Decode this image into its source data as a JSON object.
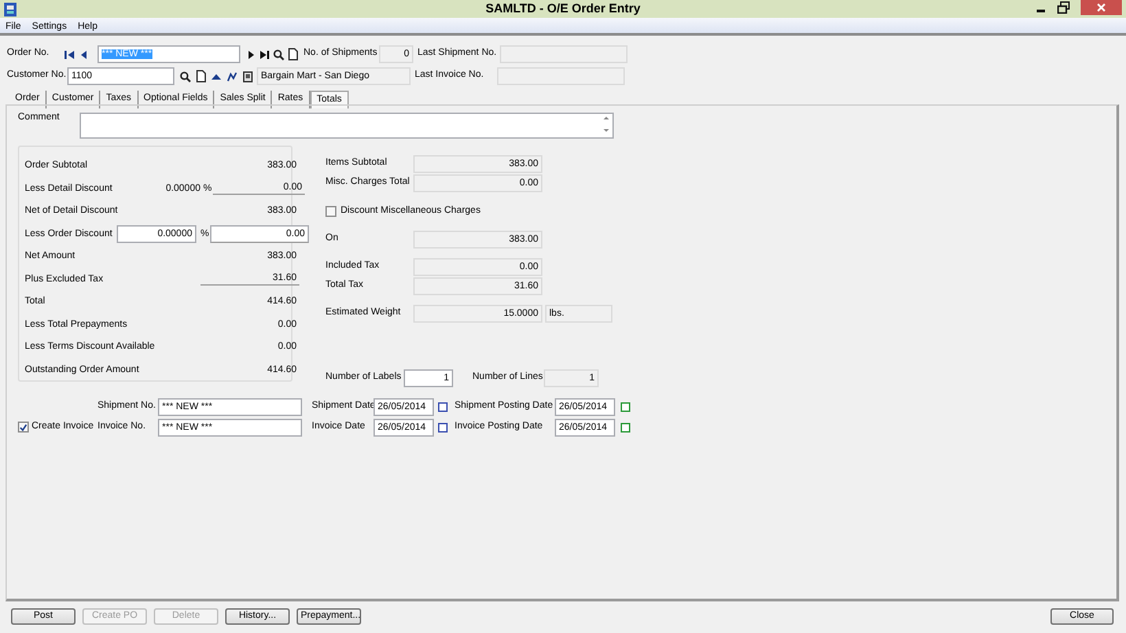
{
  "window": {
    "title": "SAMLTD - O/E Order Entry"
  },
  "menu": [
    "File",
    "Settings",
    "Help"
  ],
  "header": {
    "order_no": {
      "label": "Order No.",
      "value": "*** NEW ***",
      "selected": true
    },
    "shipments": {
      "label": "No. of Shipments",
      "value": "0"
    },
    "last_shipment": {
      "label": "Last Shipment No."
    },
    "customer_no": {
      "label": "Customer No.",
      "value": "1100",
      "name": "Bargain Mart - San Diego"
    },
    "last_invoice": {
      "label": "Last Invoice No."
    }
  },
  "tabs": [
    {
      "label": "Order",
      "selected": false
    },
    {
      "label": "Customer",
      "selected": false
    },
    {
      "label": "Taxes",
      "selected": false
    },
    {
      "label": "Optional Fields",
      "selected": false
    },
    {
      "label": "Sales Split",
      "selected": false
    },
    {
      "label": "Rates",
      "selected": false
    },
    {
      "label": "Totals",
      "selected": true
    }
  ],
  "comment": {
    "label": "Comment"
  },
  "summary": [
    {
      "kind": "plain",
      "label": "Order Subtotal",
      "value": "383.00",
      "underlined": false
    },
    {
      "kind": "percent",
      "label": "Less Detail Discount",
      "percent": "0.00000",
      "unit": "%",
      "value": "0.00",
      "underlined": true
    },
    {
      "kind": "plain",
      "label": "Net of Detail Discount",
      "value": "383.00",
      "underlined": false
    },
    {
      "kind": "percent-input",
      "label": "Less Order Discount",
      "percent": "0.00000",
      "unit": "%",
      "value": "0.00",
      "underlined": true
    },
    {
      "kind": "plain",
      "label": "Net Amount",
      "value": "383.00",
      "underlined": false
    },
    {
      "kind": "plain",
      "label": "Plus Excluded Tax",
      "value": "31.60",
      "underlined": true
    },
    {
      "kind": "plain",
      "label": "Total",
      "value": "414.60",
      "underlined": false
    },
    {
      "kind": "plain",
      "label": "Less Total Prepayments",
      "value": "0.00",
      "underlined": false
    },
    {
      "kind": "plain",
      "label": "Less Terms Discount Available",
      "value": "0.00",
      "underlined": false
    },
    {
      "kind": "plain",
      "label": "Outstanding Order Amount",
      "value": "414.60",
      "underlined": false
    }
  ],
  "totals": [
    [
      {
        "kind": "field",
        "label": "Items Subtotal",
        "value": "383.00"
      },
      {
        "kind": "field",
        "label": "Misc. Charges Total",
        "value": "0.00"
      }
    ],
    [
      {
        "kind": "checkbox",
        "label": "Discount Miscellaneous Charges",
        "checked": false
      }
    ],
    [
      {
        "kind": "field",
        "label": "On",
        "value": "383.00"
      }
    ],
    [
      {
        "kind": "field",
        "label": "Included Tax",
        "value": "0.00"
      },
      {
        "kind": "field",
        "label": "Total Tax",
        "value": "31.60"
      }
    ],
    [
      {
        "kind": "field",
        "label": "Estimated Weight",
        "value": "15.0000",
        "unit": "lbs."
      }
    ]
  ],
  "labels": {
    "label": "Number of Labels",
    "value": "1"
  },
  "lines": {
    "label": "Number of Lines",
    "value": "1"
  },
  "documents": [
    {
      "number_label": "Shipment No.",
      "number": "*** NEW ***",
      "date_label": "Shipment Date",
      "date": "26/05/2014",
      "posting_label": "Shipment Posting Date",
      "posting_date": "26/05/2014"
    },
    {
      "checkbox": {
        "label": "Create Invoice",
        "checked": true
      },
      "number_label": "Invoice No.",
      "number": "*** NEW ***",
      "date_label": "Invoice Date",
      "date": "26/05/2014",
      "posting_label": "Invoice Posting Date",
      "posting_date": "26/05/2014"
    }
  ],
  "buttons": [
    {
      "label": "Post",
      "disabled": false
    },
    {
      "label": "Create PO",
      "disabled": true
    },
    {
      "label": "Delete",
      "disabled": true
    },
    {
      "label": "History...",
      "disabled": false
    },
    {
      "label": "Prepayment...",
      "disabled": false
    }
  ],
  "close_button": {
    "label": "Close",
    "disabled": false
  }
}
